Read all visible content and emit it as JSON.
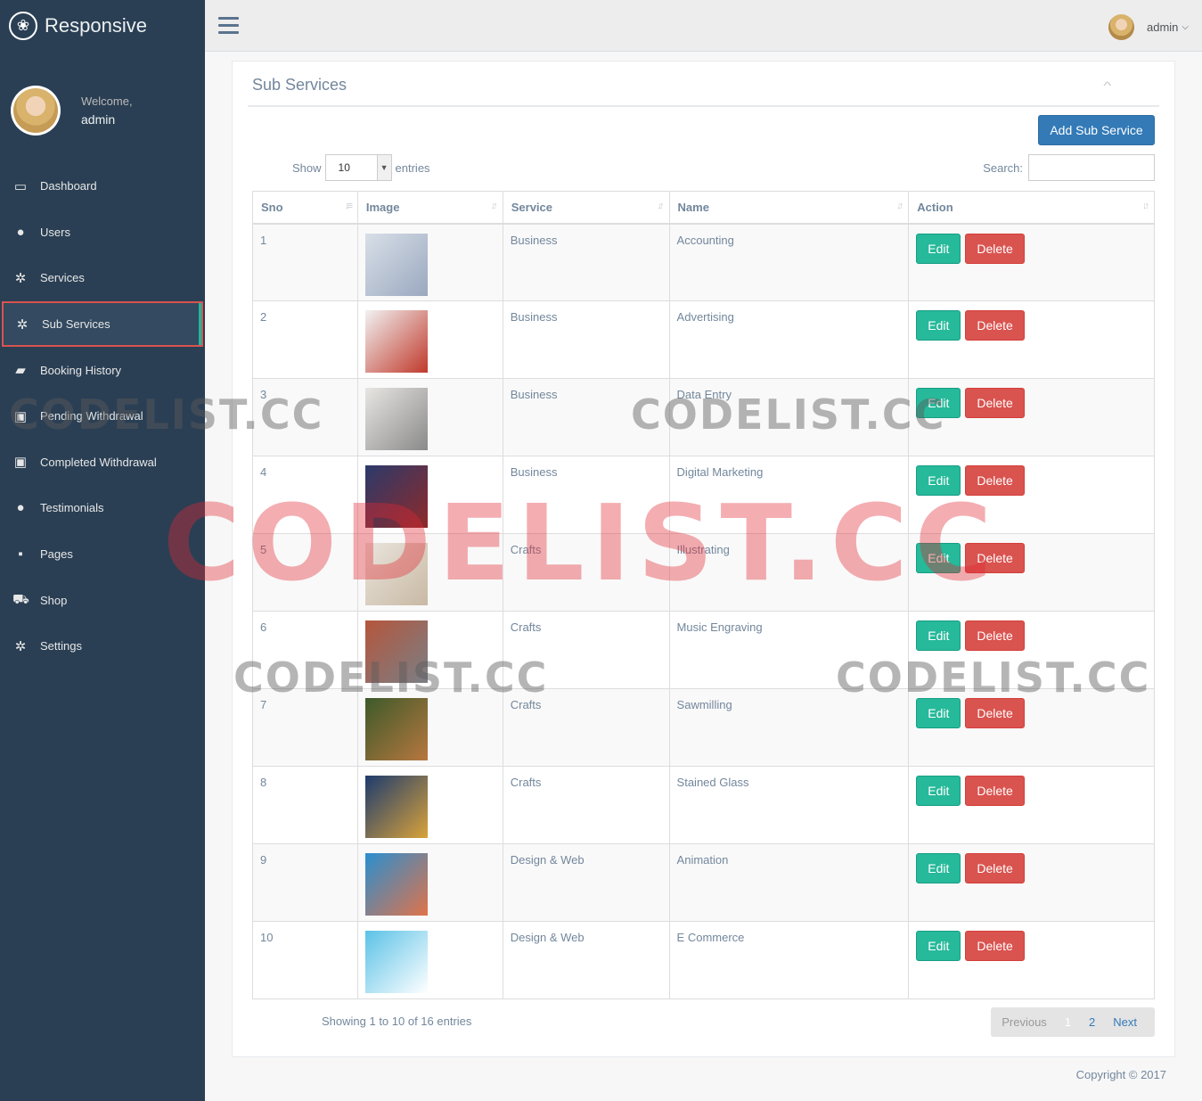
{
  "brand": {
    "name": "Responsive",
    "icon": "paw-icon"
  },
  "profile": {
    "welcome": "Welcome,",
    "name": "admin"
  },
  "menu": [
    {
      "label": "Dashboard",
      "icon": "laptop-icon",
      "glyph": "▭"
    },
    {
      "label": "Users",
      "icon": "user-icon",
      "glyph": "●"
    },
    {
      "label": "Services",
      "icon": "gear-icon",
      "glyph": "✲"
    },
    {
      "label": "Sub Services",
      "icon": "gear-icon",
      "glyph": "✲",
      "active": true
    },
    {
      "label": "Booking History",
      "icon": "book-icon",
      "glyph": "▰"
    },
    {
      "label": "Pending Withdrawal",
      "icon": "money-icon",
      "glyph": "▣"
    },
    {
      "label": "Completed Withdrawal",
      "icon": "money-icon",
      "glyph": "▣"
    },
    {
      "label": "Testimonials",
      "icon": "comments-icon",
      "glyph": "●"
    },
    {
      "label": "Pages",
      "icon": "file-icon",
      "glyph": "▪"
    },
    {
      "label": "Shop",
      "icon": "cart-icon",
      "glyph": "⛟"
    },
    {
      "label": "Settings",
      "icon": "gear-icon",
      "glyph": "✲"
    }
  ],
  "topnav": {
    "user": "admin"
  },
  "panel": {
    "title": "Sub Services",
    "add_button": "Add Sub Service",
    "show_label": "Show",
    "entries_label": "entries",
    "page_size": "10",
    "search_label": "Search:",
    "search_value": ""
  },
  "table": {
    "columns": [
      "Sno",
      "Image",
      "Service",
      "Name",
      "Action"
    ],
    "edit_label": "Edit",
    "delete_label": "Delete",
    "rows": [
      {
        "sno": "1",
        "service": "Business",
        "name": "Accounting",
        "img_colors": [
          "#d8dfe8",
          "#9aa8bf"
        ]
      },
      {
        "sno": "2",
        "service": "Business",
        "name": "Advertising",
        "img_colors": [
          "#f2f2f2",
          "#c0392b"
        ]
      },
      {
        "sno": "3",
        "service": "Business",
        "name": "Data Entry",
        "img_colors": [
          "#e8e6e3",
          "#8a8a8a"
        ]
      },
      {
        "sno": "4",
        "service": "Business",
        "name": "Digital Marketing",
        "img_colors": [
          "#2b3a6b",
          "#8e2a2a"
        ]
      },
      {
        "sno": "5",
        "service": "Crafts",
        "name": "Illustrating",
        "img_colors": [
          "#e9e4dc",
          "#c9b9a4"
        ]
      },
      {
        "sno": "6",
        "service": "Crafts",
        "name": "Music Engraving",
        "img_colors": [
          "#b5563c",
          "#7a7f86"
        ]
      },
      {
        "sno": "7",
        "service": "Crafts",
        "name": "Sawmilling",
        "img_colors": [
          "#3d5a2a",
          "#b7773f"
        ]
      },
      {
        "sno": "8",
        "service": "Crafts",
        "name": "Stained Glass",
        "img_colors": [
          "#1d3b6e",
          "#d9a23a"
        ]
      },
      {
        "sno": "9",
        "service": "Design & Web",
        "name": "Animation",
        "img_colors": [
          "#2a8fd0",
          "#e0734a"
        ]
      },
      {
        "sno": "10",
        "service": "Design & Web",
        "name": "E Commerce",
        "img_colors": [
          "#5bc2e7",
          "#ffffff"
        ]
      }
    ]
  },
  "footer_info": {
    "showing": "Showing 1 to 10 of 16 entries",
    "previous": "Previous",
    "page1": "1",
    "page2": "2",
    "next": "Next"
  },
  "copyright": "Copyright © 2017",
  "watermark": "CODELIST.CC"
}
